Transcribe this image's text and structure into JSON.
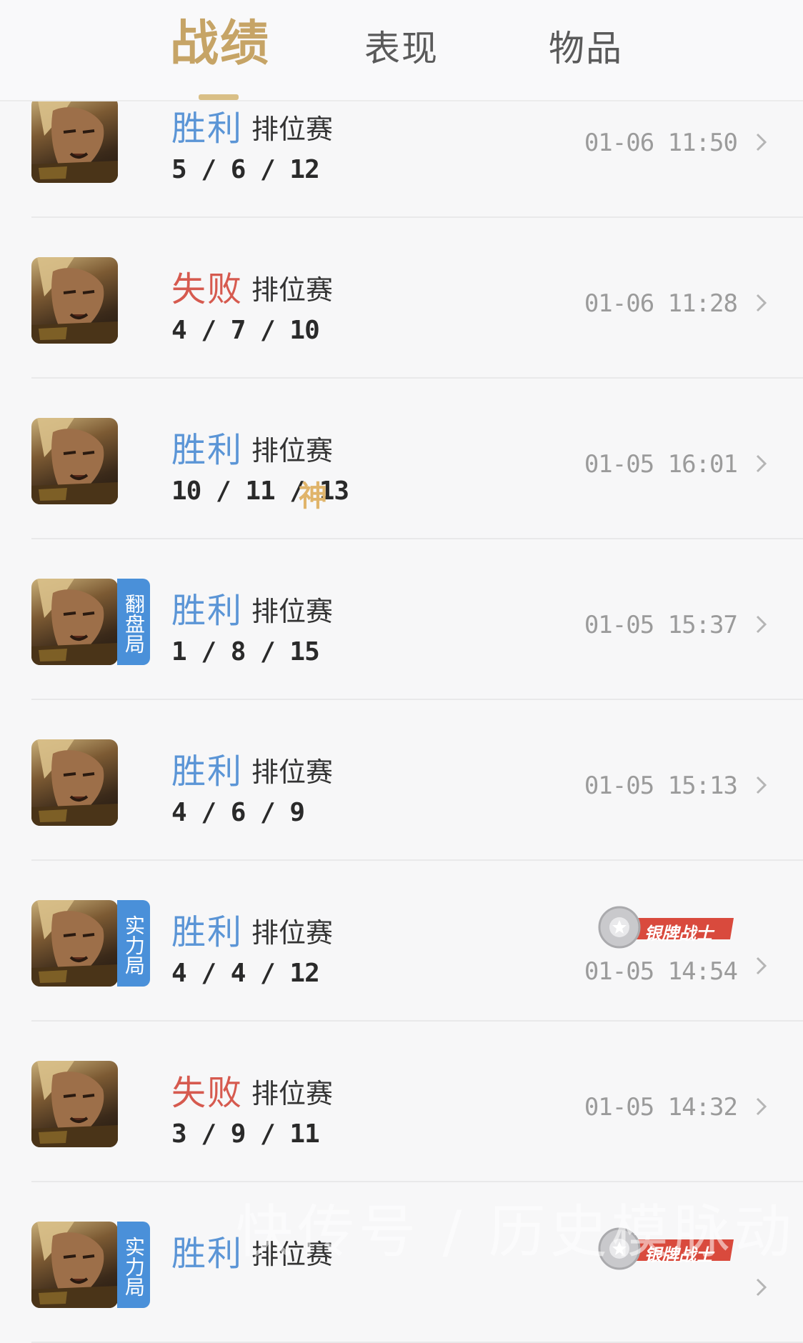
{
  "tabs": [
    {
      "label": "战绩",
      "active": true
    },
    {
      "label": "表现",
      "active": false
    },
    {
      "label": "物品",
      "active": false
    }
  ],
  "colors": {
    "accent": "#c6a466",
    "win": "#5b95d6",
    "loss": "#d65a4f",
    "tag": "#4a90d9",
    "badge": "#d94a3d"
  },
  "matches": [
    {
      "result": "胜利",
      "outcome": "win",
      "mode": "排位赛",
      "kda": "5 / 6 / 12",
      "time": "01-06 11:50"
    },
    {
      "result": "失败",
      "outcome": "loss",
      "mode": "排位赛",
      "kda": "4 / 7 / 10",
      "time": "01-06 11:28"
    },
    {
      "result": "胜利",
      "outcome": "win",
      "mode": "排位赛",
      "kda": "10 / 11 / 13",
      "time": "01-05 16:01",
      "mark": "神"
    },
    {
      "result": "胜利",
      "outcome": "win",
      "mode": "排位赛",
      "kda": "1 / 8 / 15",
      "time": "01-05 15:37",
      "tag": "翻盘局"
    },
    {
      "result": "胜利",
      "outcome": "win",
      "mode": "排位赛",
      "kda": "4 / 6 / 9",
      "time": "01-05 15:13"
    },
    {
      "result": "胜利",
      "outcome": "win",
      "mode": "排位赛",
      "kda": "4 / 4 / 12",
      "time": "01-05 14:54",
      "tag": "实力局",
      "badge": "银牌战士"
    },
    {
      "result": "失败",
      "outcome": "loss",
      "mode": "排位赛",
      "kda": "3 / 9 / 11",
      "time": "01-05 14:32"
    },
    {
      "result": "胜利",
      "outcome": "win",
      "mode": "排位赛",
      "kda": "",
      "time": "",
      "tag": "实力局",
      "badge": "银牌战士"
    }
  ],
  "icons": {
    "chevron": "chevron-right-icon",
    "avatar": "hero-avatar",
    "badge": "silver-medal-icon"
  },
  "watermark": "快传号 / 历史模脉动"
}
